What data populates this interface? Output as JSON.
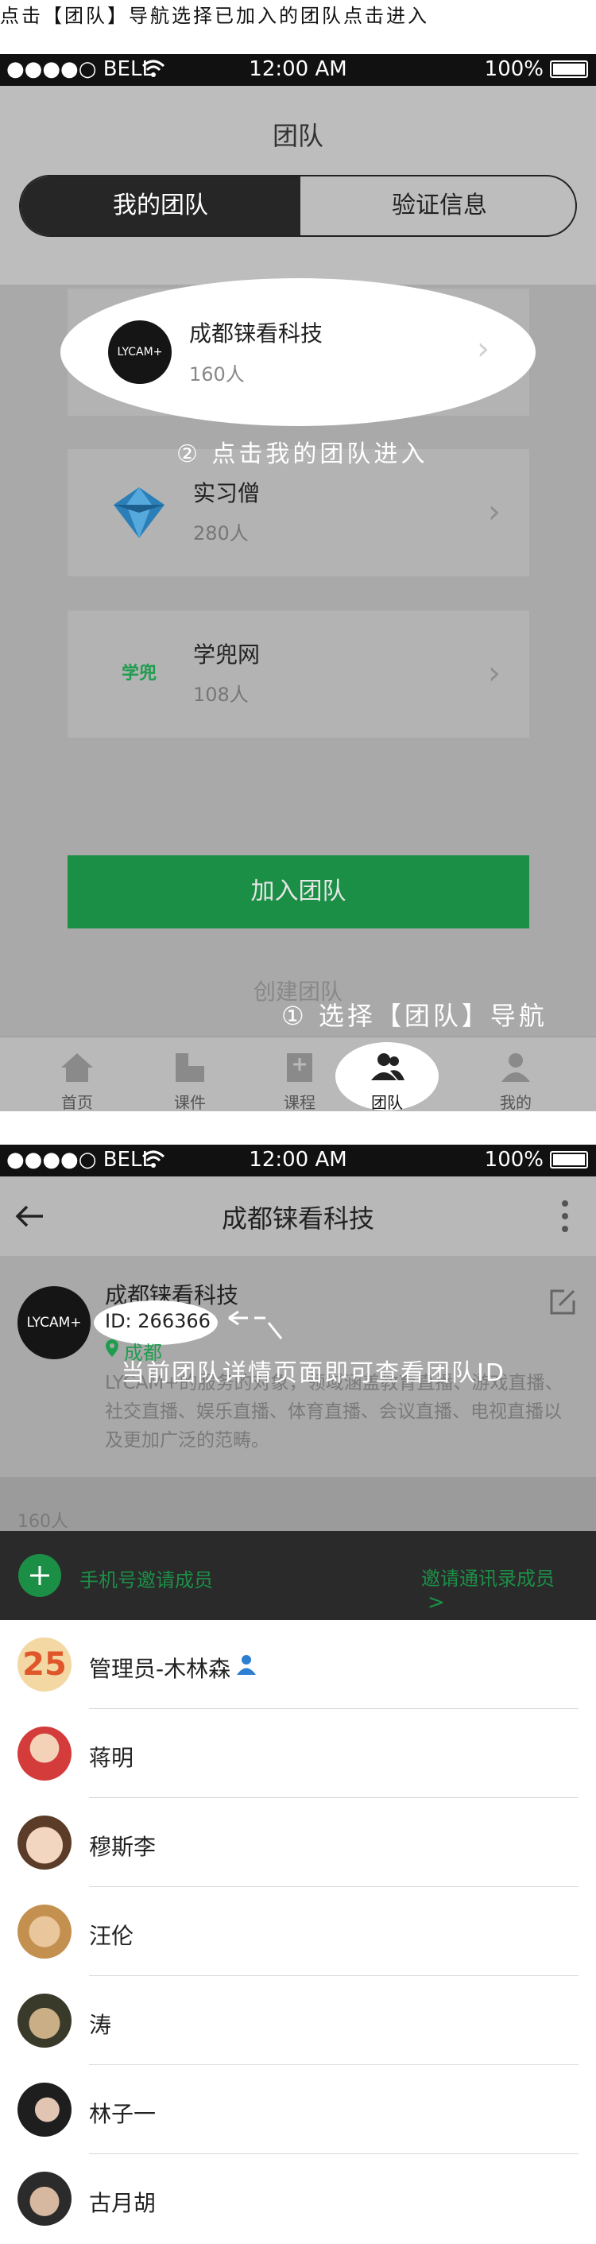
{
  "caption_top": "点击【团队】导航选择已加入的团队点击进入",
  "statusbar": {
    "carrier": "●●●●○ BELL",
    "time": "12:00 AM",
    "battery": "100%"
  },
  "screen1": {
    "title": "团队",
    "segment": {
      "left": "我的团队",
      "right": "验证信息"
    },
    "teams": [
      {
        "name": "成都铼看科技",
        "count": "160人",
        "logo_text": "LYCAM+"
      },
      {
        "name": "实习僧",
        "count": "280人"
      },
      {
        "name": "学兜网",
        "count": "108人",
        "logo_text": "学兜"
      }
    ],
    "annotation_2": "② 点击我的团队进入",
    "join_button": "加入团队",
    "create_link": "创建团队",
    "annotation_1": "① 选择【团队】导航",
    "tabbar": [
      {
        "label": "首页",
        "icon": "home-icon"
      },
      {
        "label": "课件",
        "icon": "courseware-icon"
      },
      {
        "label": "课程",
        "icon": "course-icon"
      },
      {
        "label": "团队",
        "icon": "team-icon"
      },
      {
        "label": "我的",
        "icon": "profile-icon"
      }
    ]
  },
  "screen2": {
    "title": "成都铼看科技",
    "team": {
      "name": "成都铼看科技",
      "id": "ID: 266366",
      "location": "成都",
      "logo_text": "LYCAM+",
      "description": "LYCAM+的服务的对象，领域涵盖教育直播、游戏直播、社交直播、娱乐直播、体育直播、会议直播、电视直播以及更加广泛的范畴。"
    },
    "annotation_3": "当前团队详情页面即可查看团队ID",
    "member_count": "160人",
    "invite_phone": "手机号邀请成员",
    "invite_contacts": "邀请通讯录成员",
    "members": [
      {
        "name": "管理员-木林森",
        "admin": true
      },
      {
        "name": "蒋明"
      },
      {
        "name": "穆斯李"
      },
      {
        "name": "汪伦"
      },
      {
        "name": "涛"
      },
      {
        "name": "林子一"
      },
      {
        "name": "古月胡"
      }
    ],
    "colors": {
      "green": "#1f9d4f",
      "dark_bar": "#2a2a2a"
    }
  }
}
